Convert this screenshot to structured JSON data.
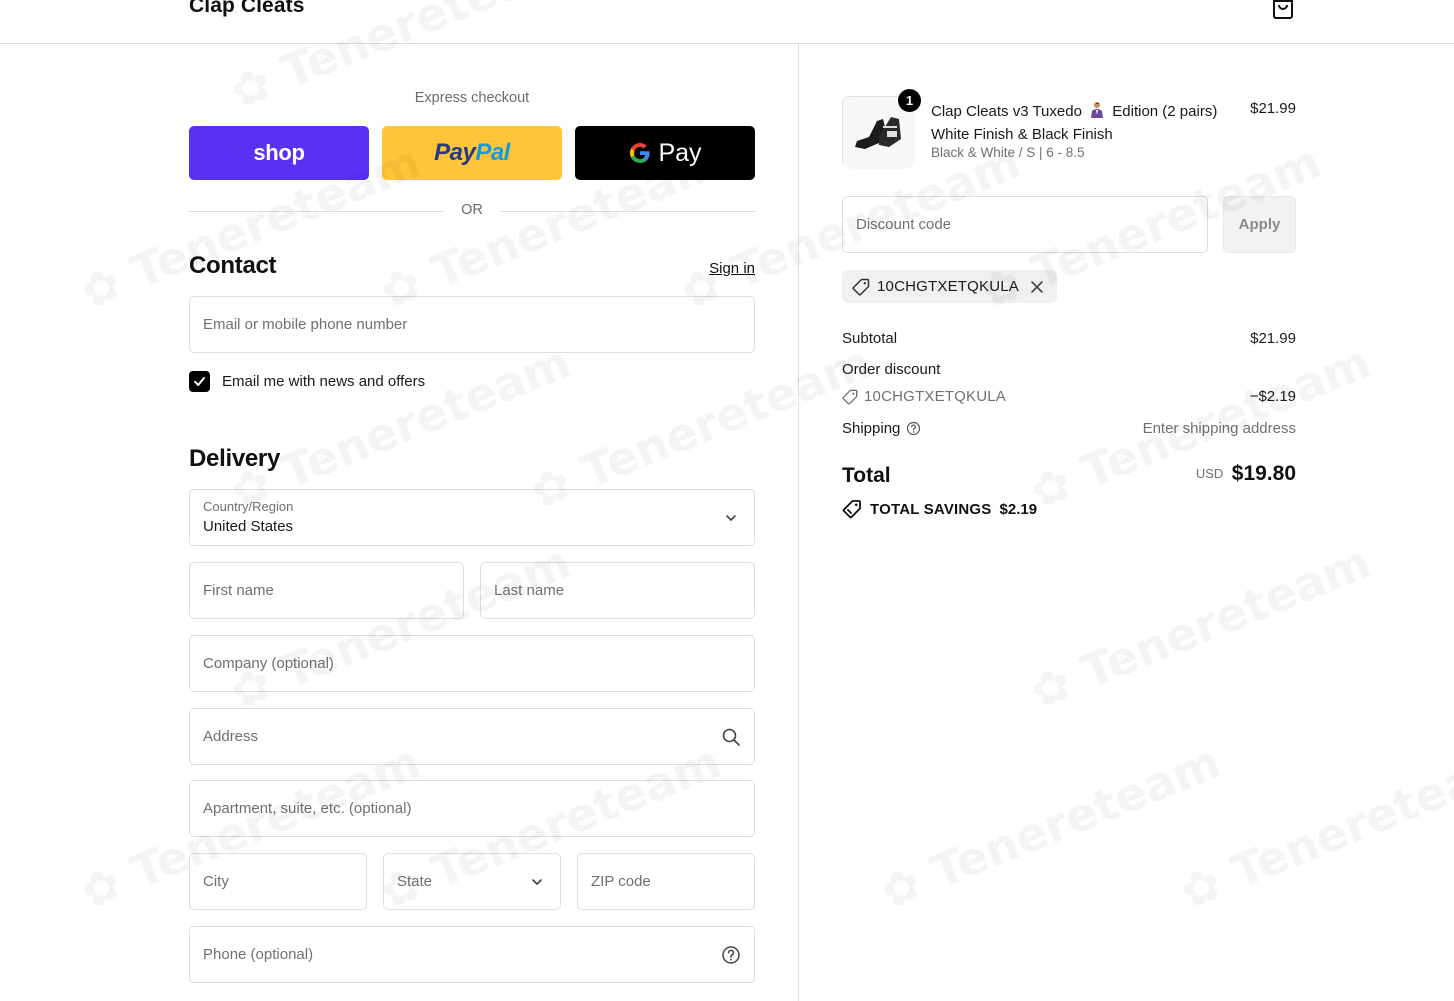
{
  "header": {
    "brand": "Clap Cleats",
    "cart_icon": "shopping-bag-icon"
  },
  "express": {
    "label": "Express checkout",
    "shop_label": "shop",
    "paypal_label_a": "Pay",
    "paypal_label_b": "Pal",
    "gpay_label": "Pay",
    "or_label": "OR"
  },
  "contact": {
    "title": "Contact",
    "sign_in": "Sign in",
    "email_placeholder": "Email or mobile phone number",
    "news_checkbox_label": "Email me with news and offers",
    "news_checked": true
  },
  "delivery": {
    "title": "Delivery",
    "country_label": "Country/Region",
    "country_value": "United States",
    "first_name_placeholder": "First name",
    "last_name_placeholder": "Last name",
    "company_placeholder": "Company (optional)",
    "address_placeholder": "Address",
    "apartment_placeholder": "Apartment, suite, etc. (optional)",
    "city_placeholder": "City",
    "state_placeholder": "State",
    "zip_placeholder": "ZIP code",
    "phone_placeholder": "Phone (optional)"
  },
  "summary": {
    "product": {
      "quantity": "1",
      "title_a": "Clap Cleats v3 Tuxedo",
      "title_b": "Edition (2 pairs)",
      "title_c": "White Finish & Black Finish",
      "variant": "Black & White / S | 6 - 8.5",
      "price": "$21.99"
    },
    "discount_placeholder": "Discount code",
    "apply_label": "Apply",
    "applied_code": "10CHGTXETQKULA",
    "subtotal_label": "Subtotal",
    "subtotal_value": "$21.99",
    "order_discount_label": "Order discount",
    "discount_code_line": "10CHGTXETQKULA",
    "discount_amount": "−$2.19",
    "shipping_label": "Shipping",
    "shipping_value": "Enter shipping address",
    "total_label": "Total",
    "total_currency": "USD",
    "total_value": "$19.80",
    "savings_label": "TOTAL SAVINGS",
    "savings_value": "$2.19"
  },
  "colors": {
    "shop_pay": "#5a31f4",
    "paypal": "#ffc439",
    "gpay": "#000000"
  }
}
